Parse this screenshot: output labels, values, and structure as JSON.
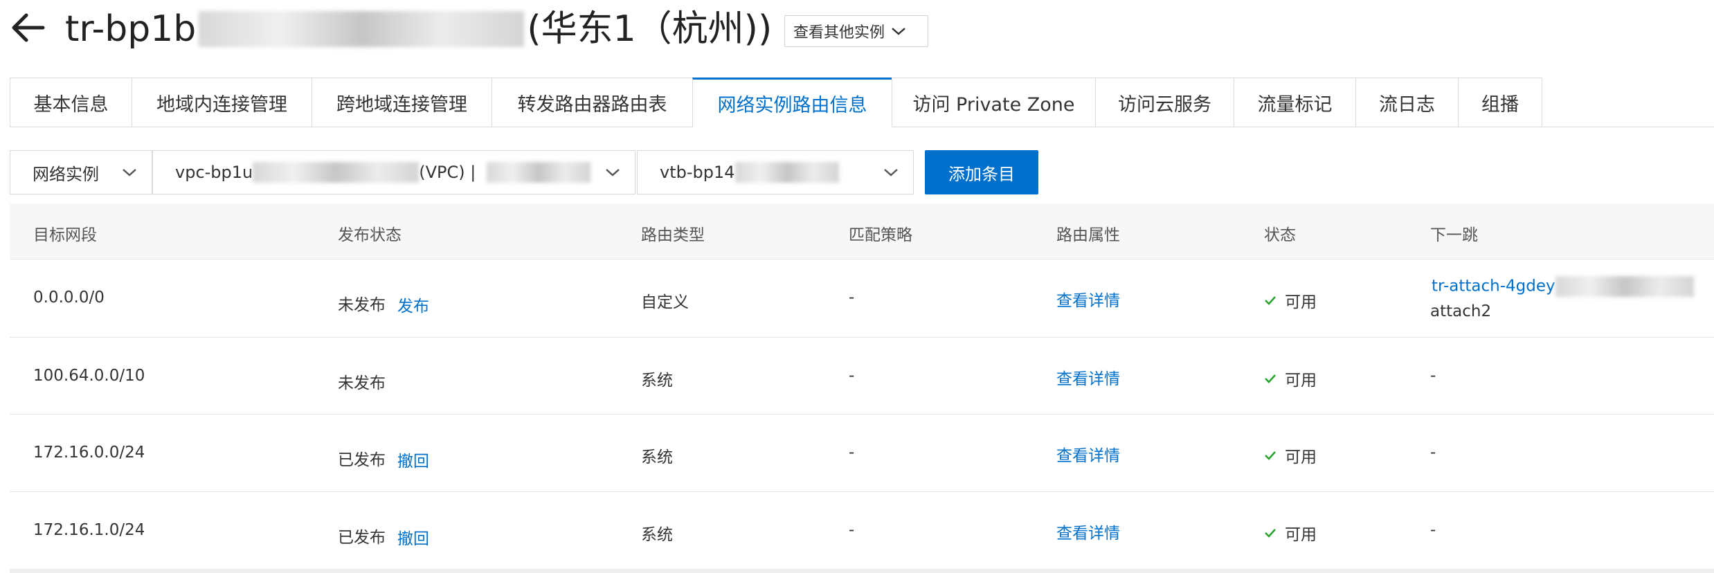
{
  "header": {
    "title_prefix": "tr-bp1b",
    "title_suffix": "(华东1（杭州))",
    "other_instances_label": "查看其他实例"
  },
  "tabs": [
    {
      "label": "基本信息"
    },
    {
      "label": "地域内连接管理"
    },
    {
      "label": "跨地域连接管理"
    },
    {
      "label": "转发路由器路由表"
    },
    {
      "label": "网络实例路由信息"
    },
    {
      "label": "访问 Private Zone"
    },
    {
      "label": "访问云服务"
    },
    {
      "label": "流量标记"
    },
    {
      "label": "流日志"
    },
    {
      "label": "组播"
    }
  ],
  "active_tab": "网络实例路由信息",
  "filters": {
    "instance_type": "网络实例",
    "vpc_prefix": "vpc-bp1u",
    "vpc_suffix": "(VPC) |",
    "route_table_prefix": "vtb-bp14"
  },
  "add_button_label": "添加条目",
  "table": {
    "columns": [
      "目标网段",
      "发布状态",
      "路由类型",
      "匹配策略",
      "路由属性",
      "状态",
      "下一跳"
    ],
    "rows": [
      {
        "cidr": "0.0.0.0/0",
        "publish_status": "未发布",
        "publish_action": "发布",
        "route_type": "自定义",
        "match_policy": "-",
        "route_attr": "查看详情",
        "status": "可用",
        "next_hop_link": "tr-attach-4gdey",
        "next_hop_sub": "attach2"
      },
      {
        "cidr": "100.64.0.0/10",
        "publish_status": "未发布",
        "publish_action": "",
        "route_type": "系统",
        "match_policy": "-",
        "route_attr": "查看详情",
        "status": "可用",
        "next_hop_link": "",
        "next_hop_sub": "-"
      },
      {
        "cidr": "172.16.0.0/24",
        "publish_status": "已发布",
        "publish_action": "撤回",
        "route_type": "系统",
        "match_policy": "-",
        "route_attr": "查看详情",
        "status": "可用",
        "next_hop_link": "",
        "next_hop_sub": "-"
      },
      {
        "cidr": "172.16.1.0/24",
        "publish_status": "已发布",
        "publish_action": "撤回",
        "route_type": "系统",
        "match_policy": "-",
        "route_attr": "查看详情",
        "status": "可用",
        "next_hop_link": "",
        "next_hop_sub": "-"
      }
    ]
  },
  "colors": {
    "accent": "#0070cc",
    "status_ok": "#27a327"
  },
  "icons": [
    "back-arrow-icon",
    "chevron-down-icon",
    "check-icon"
  ]
}
